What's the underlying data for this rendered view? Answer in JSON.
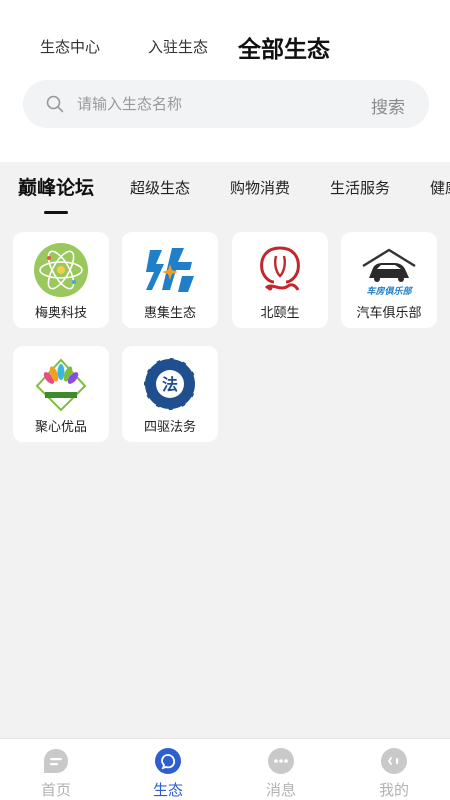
{
  "header": {
    "tabs": [
      {
        "label": "生态中心",
        "active": false
      },
      {
        "label": "入驻生态",
        "active": false
      },
      {
        "label": "全部生态",
        "active": true
      }
    ]
  },
  "search": {
    "placeholder": "请输入生态名称",
    "value": "",
    "button_label": "搜索",
    "icon": "search-icon"
  },
  "categories": [
    {
      "label": "巅峰论坛",
      "active": true
    },
    {
      "label": "超级生态",
      "active": false
    },
    {
      "label": "购物消费",
      "active": false
    },
    {
      "label": "生活服务",
      "active": false
    },
    {
      "label": "健康",
      "active": false
    }
  ],
  "ecosystems": [
    {
      "name": "梅奥科技",
      "logo": "atom-logo"
    },
    {
      "name": "惠集生态",
      "logo": "hj-logo"
    },
    {
      "name": "北颐生",
      "logo": "beiyisheng-logo"
    },
    {
      "name": "汽车俱乐部",
      "logo": "car-club-logo"
    },
    {
      "name": "聚心优品",
      "logo": "peacock-logo"
    },
    {
      "name": "四驱法务",
      "logo": "fa-logo"
    }
  ],
  "car_logo_text": "车房俱乐部",
  "fa_logo_text": "法",
  "bottom_nav": [
    {
      "label": "首页",
      "icon": "home-icon",
      "active": false
    },
    {
      "label": "生态",
      "icon": "ecosystem-icon",
      "active": true
    },
    {
      "label": "消息",
      "icon": "message-icon",
      "active": false
    },
    {
      "label": "我的",
      "icon": "profile-icon",
      "active": false
    }
  ],
  "colors": {
    "accent": "#2d5fcf",
    "inactive_nav": "#b3b3b3",
    "background": "#f2f2f2"
  }
}
